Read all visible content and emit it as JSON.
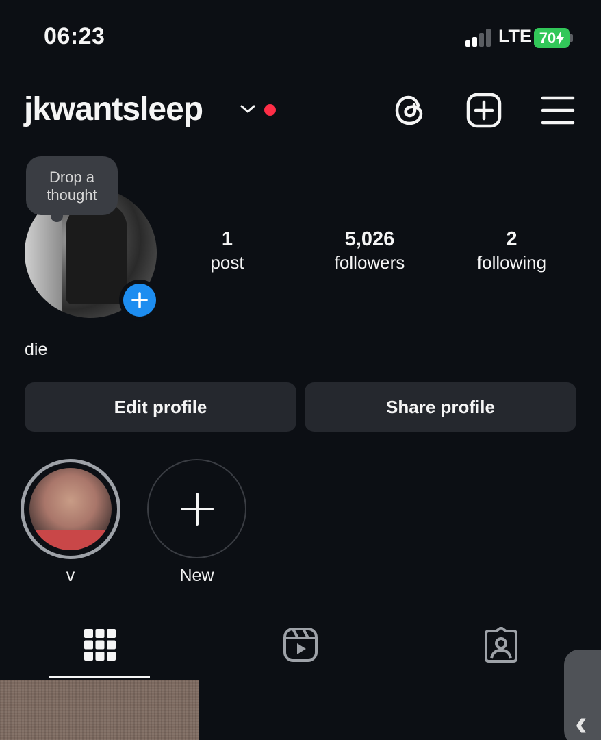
{
  "status_bar": {
    "time": "06:23",
    "network": "LTE",
    "battery": "70"
  },
  "header": {
    "username": "jkwantsleep",
    "icons": [
      "chevron-down-icon",
      "threads-icon",
      "create-post-icon",
      "menu-icon"
    ]
  },
  "profile": {
    "note_bubble": "Drop a thought",
    "stats": [
      {
        "value": "1",
        "label": "post"
      },
      {
        "value": "5,026",
        "label": "followers"
      },
      {
        "value": "2",
        "label": "following"
      }
    ],
    "bio": "die"
  },
  "actions": {
    "edit_label": "Edit profile",
    "share_label": "Share profile"
  },
  "highlights": [
    {
      "label": "v"
    },
    {
      "label": "New"
    }
  ],
  "tabs": [
    "grid-tab-icon",
    "reels-tab-icon",
    "tagged-tab-icon"
  ],
  "colors": {
    "background": "#0c0f14",
    "button": "#25282e",
    "accent_blue": "#1d8df0",
    "notification_red": "#ff2e47",
    "battery_green": "#32c759"
  }
}
